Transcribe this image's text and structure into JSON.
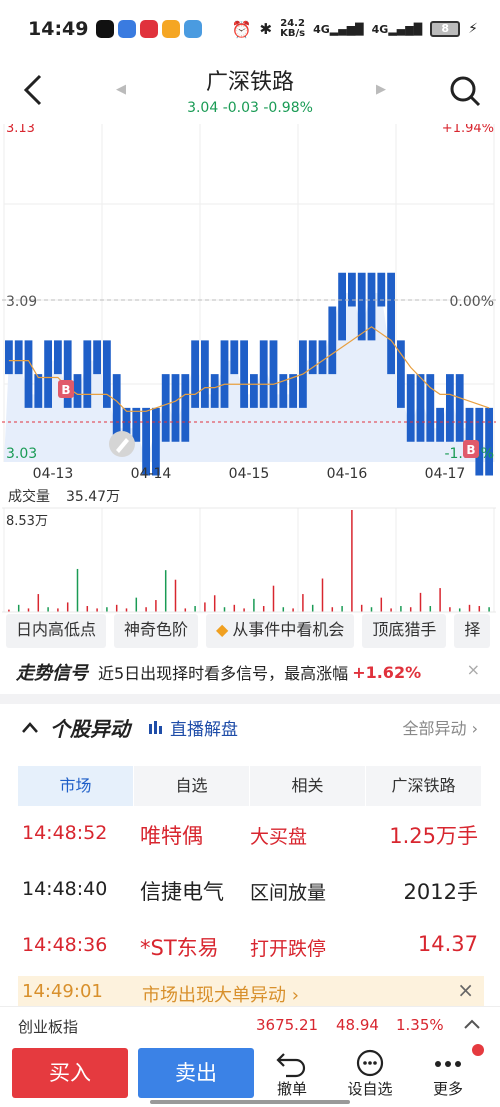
{
  "status": {
    "time": "14:49",
    "speed_top": "24.2",
    "speed_bottom": "KB/s",
    "net1": "4G",
    "net2": "4G",
    "battery": "8"
  },
  "header": {
    "title": "广深铁路",
    "quote": "3.04 -0.03 -0.98%"
  },
  "chart": {
    "labels": {
      "price_top_left": "3.13",
      "pct_top_right": "+1.94%",
      "price_mid": "3.09",
      "pct_mid": "0.00%",
      "price_low": "3.03",
      "pct_low": "-1.94%"
    },
    "markers": [
      "B",
      "B"
    ],
    "volume_label": "成交量",
    "volume_total": "35.47万",
    "volume_max": "8.53万"
  },
  "chart_data": {
    "type": "line",
    "x": [
      "04-13",
      "04-14",
      "04-15",
      "04-16",
      "04-17"
    ],
    "ylim": [
      3.03,
      3.13
    ],
    "reference_price": 3.09,
    "series": [
      {
        "values": [
          3.06,
          3.06,
          3.05,
          3.05,
          3.06,
          3.06,
          3.05,
          3.05,
          3.06,
          3.06,
          3.05,
          3.04,
          3.04,
          3.04,
          3.03,
          3.04,
          3.05,
          3.04,
          3.05,
          3.06,
          3.05,
          3.05,
          3.06,
          3.06,
          3.05,
          3.05,
          3.06,
          3.05,
          3.05,
          3.05,
          3.06,
          3.06,
          3.06,
          3.07,
          3.08,
          3.08,
          3.07,
          3.08,
          3.08,
          3.06,
          3.05,
          3.04,
          3.05,
          3.04,
          3.04,
          3.05,
          3.04,
          3.04,
          3.03,
          3.04
        ]
      },
      {
        "values": [
          3.06,
          3.06,
          3.06,
          3.055,
          3.055,
          3.055,
          3.052,
          3.05,
          3.05,
          3.05,
          3.05,
          3.048,
          3.045,
          3.045,
          3.045,
          3.046,
          3.047,
          3.048,
          3.05,
          3.05,
          3.052,
          3.052,
          3.053,
          3.053,
          3.053,
          3.053,
          3.053,
          3.053,
          3.054,
          3.055,
          3.056,
          3.058,
          3.06,
          3.062,
          3.064,
          3.066,
          3.068,
          3.07,
          3.068,
          3.066,
          3.062,
          3.058,
          3.055,
          3.052,
          3.05,
          3.05,
          3.049,
          3.048,
          3.047,
          3.046
        ]
      }
    ],
    "volume": {
      "unit": "万",
      "ylim": [
        0,
        8.53
      ],
      "values": [
        0.2,
        0.6,
        0.3,
        1.5,
        0.4,
        0.3,
        0.8,
        3.6,
        0.5,
        0.3,
        0.4,
        0.6,
        0.3,
        1.2,
        0.4,
        1.0,
        3.5,
        2.7,
        0.3,
        0.5,
        0.8,
        1.4,
        0.4,
        0.6,
        0.3,
        1.1,
        0.5,
        2.2,
        0.4,
        0.3,
        1.5,
        0.6,
        2.8,
        0.4,
        0.5,
        8.53,
        0.6,
        0.4,
        1.2,
        0.3,
        0.5,
        0.4,
        1.6,
        0.5,
        2.0,
        0.4,
        0.3,
        0.6,
        0.5,
        0.4
      ]
    }
  },
  "tool_tabs": [
    "日内高低点",
    "神奇色阶",
    "从事件中看机会",
    "顶底猎手",
    "择"
  ],
  "signal": {
    "brand": "走势信号",
    "text": "近5日出现择时看多信号，最高涨幅",
    "gain": "+1.62%",
    "close": "×"
  },
  "module": {
    "caret": "^",
    "title": "个股异动",
    "live": "直播解盘",
    "all": "全部异动 ›"
  },
  "seg_tabs": [
    "市场",
    "自选",
    "相关",
    "广深铁路"
  ],
  "rows": [
    {
      "time": "14:48:52",
      "name": "唯特偶",
      "event": "大买盘",
      "value": "1.25万手"
    },
    {
      "time": "14:48:40",
      "name": "信捷电气",
      "event": "区间放量",
      "value": "2012手"
    },
    {
      "time": "14:48:36",
      "name": "*ST东易",
      "event": "打开跌停",
      "value": "14.37"
    }
  ],
  "notice": {
    "time": "14:49:01",
    "text": "市场出现大单异动 ›",
    "close": "×"
  },
  "index": {
    "name": "创业板指",
    "value": "3675.21",
    "change": "48.94",
    "pct": "1.35%",
    "toggle": "^"
  },
  "bottom": {
    "buy": "买入",
    "sell": "卖出",
    "cancel": "撤单",
    "watch": "设自选",
    "more": "更多"
  },
  "colors": {
    "up": "#d8262f",
    "down": "#1a9b55",
    "price_line": "#1f5fc8",
    "avg_line": "#e8a040",
    "buy": "#e53a3f",
    "sell": "#3b82e6"
  }
}
